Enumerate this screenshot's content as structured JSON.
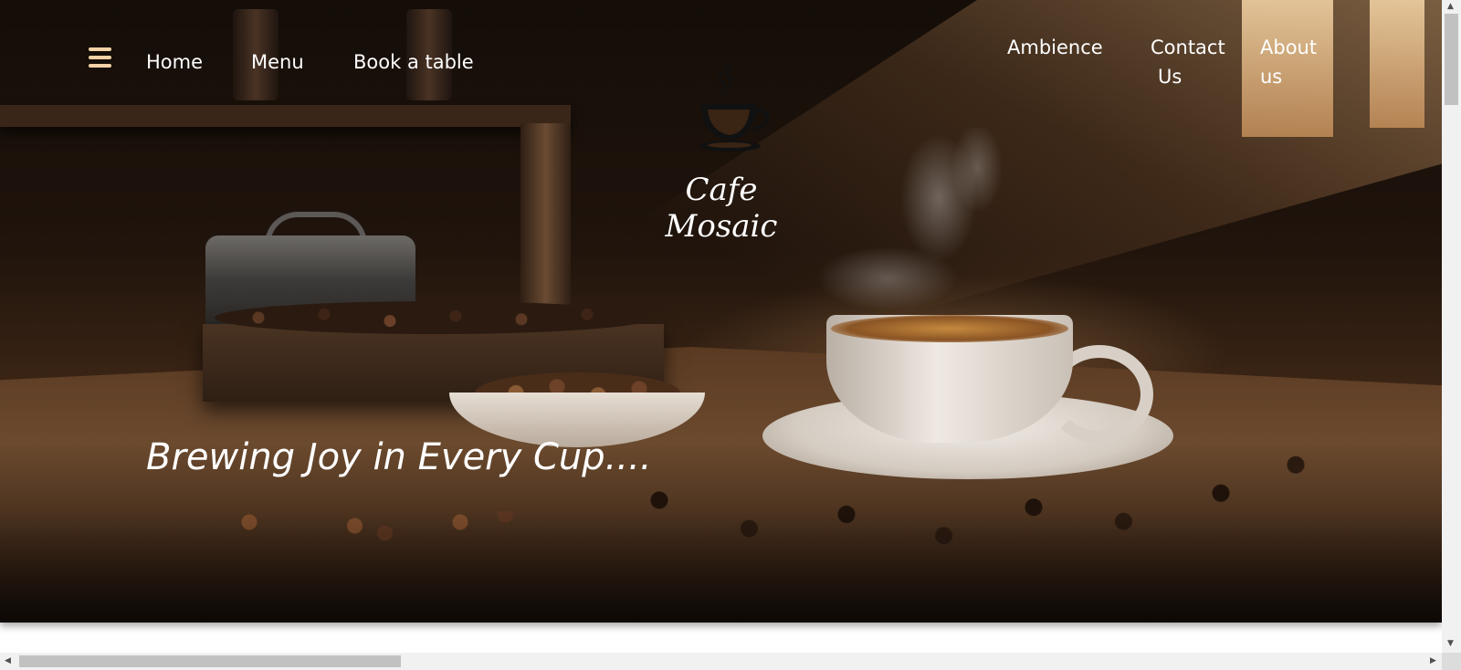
{
  "nav": {
    "menu_icon": "hamburger-menu-icon",
    "left_links": [
      "Home",
      "Menu",
      "Book a table"
    ],
    "right_links": [
      {
        "line1": "Ambience",
        "line2": ""
      },
      {
        "line1": "Contact",
        "line2": "Us"
      },
      {
        "line1": "About",
        "line2": "us"
      }
    ]
  },
  "brand": {
    "icon": "coffee-cup-logo-icon",
    "name": "Cafe Mosaic"
  },
  "hero": {
    "tagline": "Brewing Joy in Every Cup...."
  },
  "colors": {
    "nav_text": "#ffffff",
    "menu_icon": "#f3d2a6",
    "scrollbar_track": "#f1f1f1",
    "scrollbar_thumb": "#c1c1c1"
  }
}
